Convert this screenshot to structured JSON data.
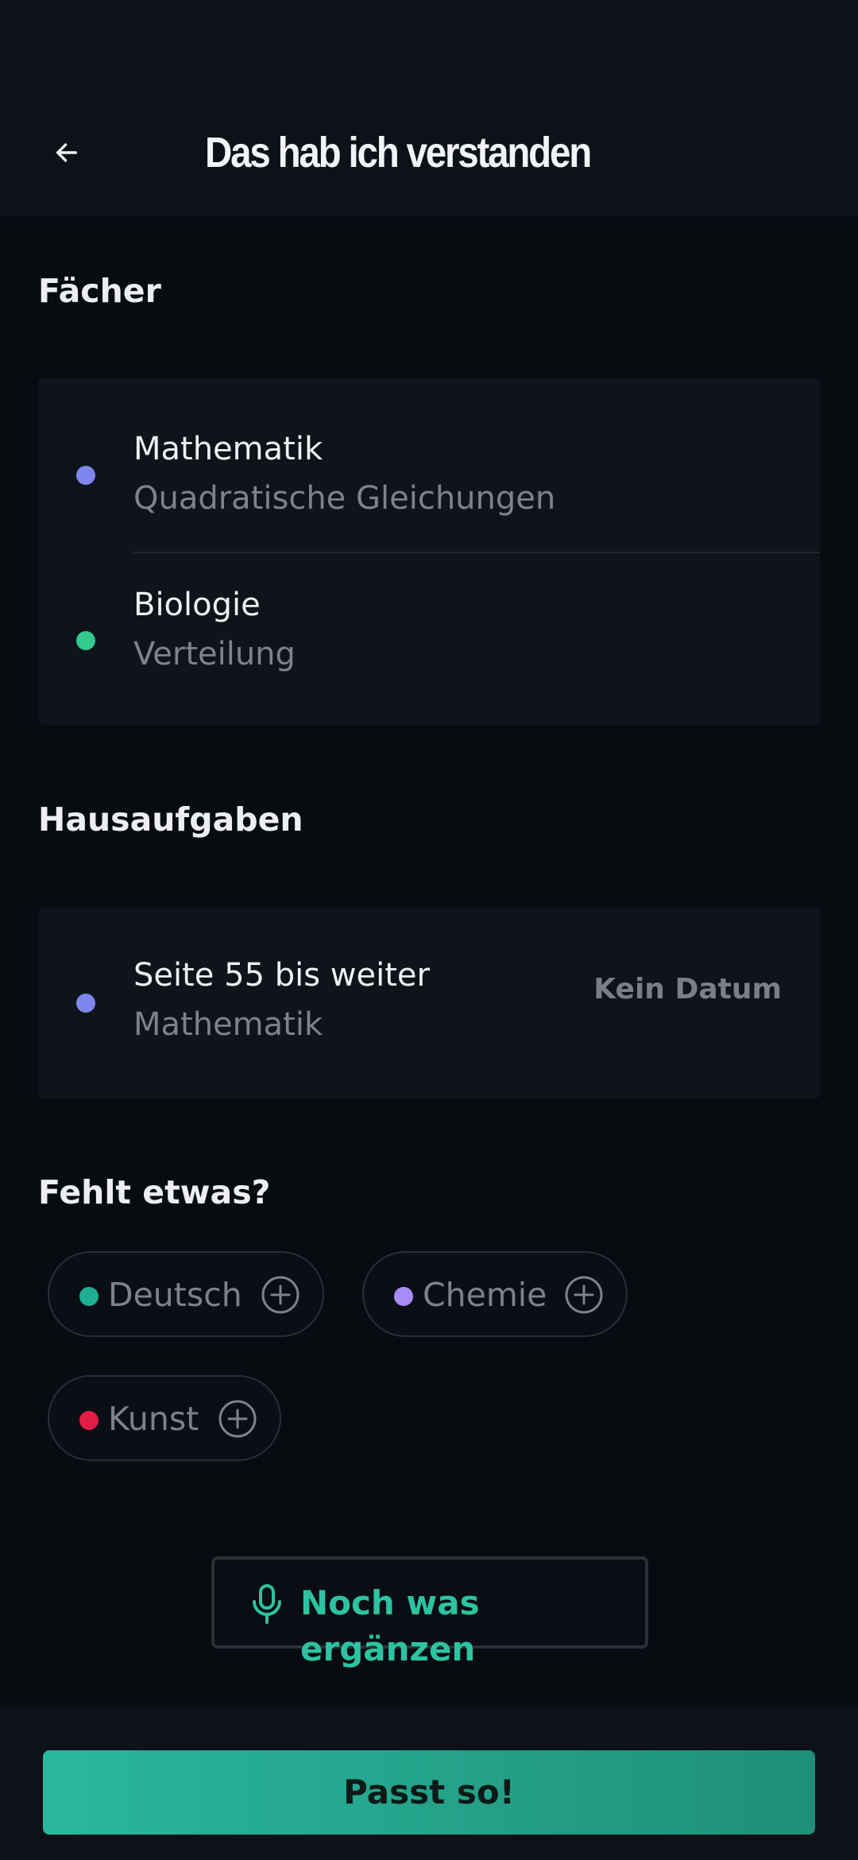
{
  "header": {
    "title": "Das hab ich verstanden",
    "back_icon": "arrow-left-icon"
  },
  "subjects": {
    "title": "Fächer",
    "items": [
      {
        "name": "Mathematik",
        "topic": "Quadratische Gleichungen",
        "color": "#7f86ee"
      },
      {
        "name": "Biologie",
        "topic": "Verteilung",
        "color": "#33c98f"
      }
    ]
  },
  "homework": {
    "title": "Hausaufgaben",
    "items": [
      {
        "task": "Seite 55 bis weiter",
        "subject": "Mathematik",
        "due": "Kein Datum",
        "color": "#7f86ee"
      }
    ]
  },
  "missing": {
    "title": "Fehlt etwas?",
    "chips": [
      {
        "label": "Deutsch",
        "color": "#1fae92",
        "icon": "plus-circle-icon"
      },
      {
        "label": "Chemie",
        "color": "#a78bfa",
        "icon": "plus-circle-icon"
      },
      {
        "label": "Kunst",
        "color": "#e11d48",
        "icon": "plus-circle-icon"
      }
    ]
  },
  "add_more": {
    "label": "Noch was ergänzen",
    "icon": "microphone-icon",
    "color": "#2cc3a1"
  },
  "confirm": {
    "label": "Passt so!"
  }
}
